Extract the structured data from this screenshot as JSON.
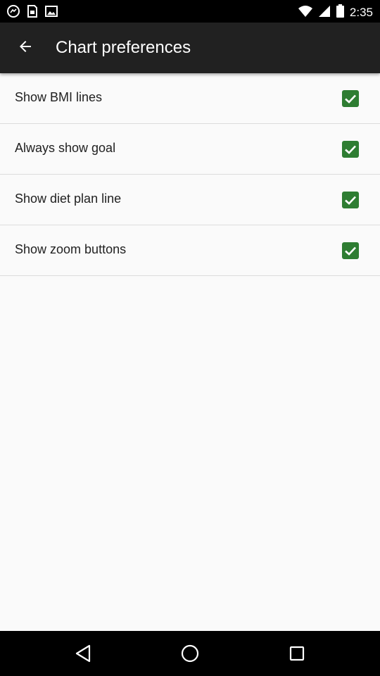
{
  "status_bar": {
    "time": "2:35",
    "left_icons": [
      "messenger-icon",
      "sim-icon",
      "image-icon"
    ],
    "right_icons": [
      "wifi-icon",
      "signal-icon",
      "battery-icon"
    ]
  },
  "app_bar": {
    "title": "Chart preferences",
    "back_icon": "arrow-back-icon",
    "background": "#212121"
  },
  "preferences": [
    {
      "label": "Show BMI lines",
      "checked": true
    },
    {
      "label": "Always show goal",
      "checked": true
    },
    {
      "label": "Show diet plan line",
      "checked": true
    },
    {
      "label": "Show zoom buttons",
      "checked": true
    }
  ],
  "colors": {
    "accent": "#2e7d32",
    "background": "#fafafa",
    "divider": "#dcdcdc"
  },
  "nav_bar": {
    "buttons": [
      "back-triangle-icon",
      "home-circle-icon",
      "recents-square-icon"
    ]
  }
}
